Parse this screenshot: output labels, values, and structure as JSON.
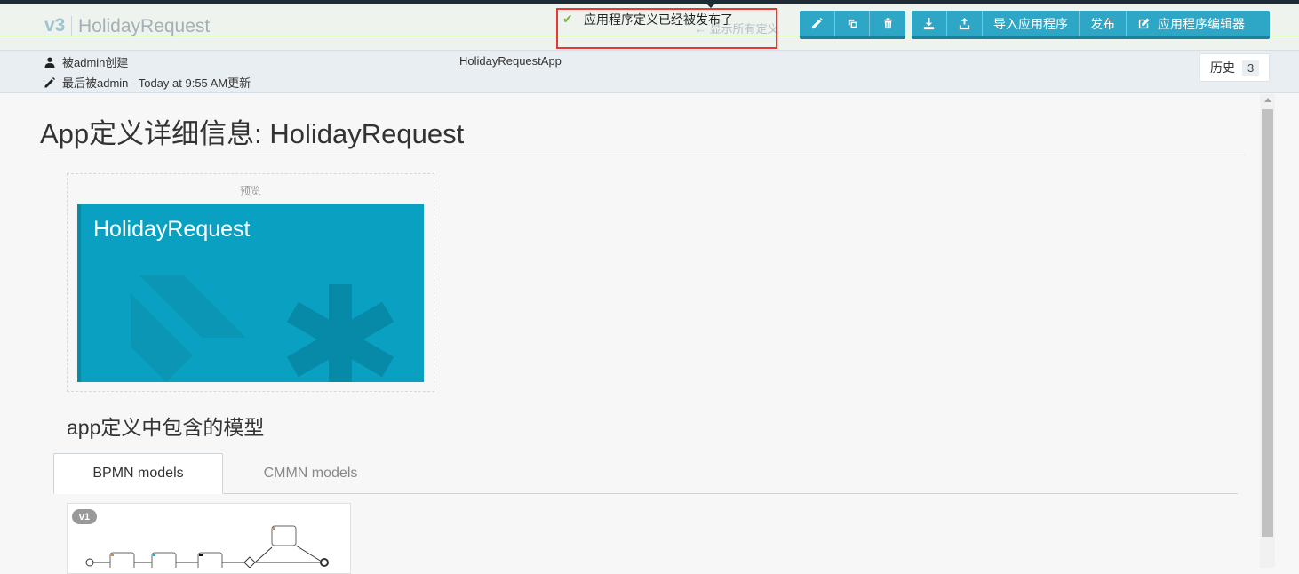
{
  "header": {
    "version": "v3",
    "app_title": "HolidayRequest",
    "show_all_link": "← 显示所有定义",
    "created_by": "被admin创建",
    "updated_by": "最后被admin - Today at 9:55 AM更新",
    "app_key": "HolidayRequestApp",
    "history_label": "历史",
    "history_count": "3"
  },
  "toolbar": {
    "edit_icon": "pencil-icon",
    "copy_icon": "copy-icon",
    "delete_icon": "trash-icon",
    "export_icon": "download-icon",
    "export_bar_icon": "export-icon",
    "import_label": "导入应用程序",
    "publish_label": "发布",
    "editor_label": "应用程序编辑器",
    "editor_icon": "edit-square-icon"
  },
  "toast": {
    "icon": "check-icon",
    "message": "应用程序定义已经被发布了"
  },
  "main": {
    "page_title": "App定义详细信息: HolidayRequest",
    "preview_label": "预览",
    "tile_name": "HolidayRequest",
    "models_title": "app定义中包含的模型",
    "tabs": [
      {
        "label": "BPMN models",
        "active": true
      },
      {
        "label": "CMMN models",
        "active": false
      }
    ],
    "model_card": {
      "version_badge": "v1"
    }
  },
  "colors": {
    "accent": "#2ea7c6",
    "tile": "#0aa0c2",
    "toast_border": "#e53935",
    "success": "#7cb342"
  }
}
